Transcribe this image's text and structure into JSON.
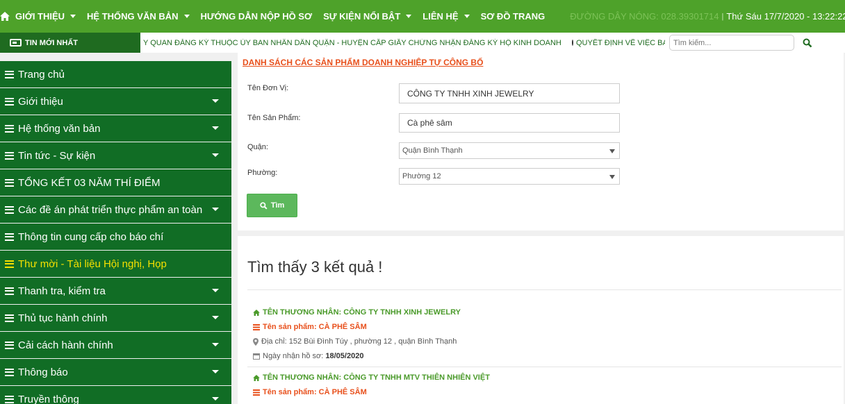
{
  "topnav": {
    "items": [
      {
        "label": "GIỚI THIỆU",
        "caret": true
      },
      {
        "label": "HỆ THỐNG VĂN BẢN",
        "caret": true
      },
      {
        "label": "HƯỚNG DẪN NỘP HỒ SƠ",
        "caret": false
      },
      {
        "label": "SỰ KIỆN NỔI BẬT",
        "caret": true
      },
      {
        "label": "LIÊN HỆ",
        "caret": true
      },
      {
        "label": "SƠ ĐỒ TRANG",
        "caret": false
      }
    ],
    "hotline": "ĐƯỜNG DÂY NÓNG: 028.39301714",
    "separator": "|",
    "datetime": "Thứ Sáu 17/7/2020 - 13:22:22"
  },
  "newsbar": {
    "label": "TIN MỚI NHẤT",
    "ticker": "Y QUAN ĐĂNG KÝ THUỘC ỦY BAN NHÂN DÂN QUẬN - HUYỆN CẤP GIẤY CHỨNG NHẬN ĐĂNG KÝ HỘ KINH DOANH",
    "ticker2": "QUYẾT ĐỊNH VỀ VIỆC BAN HÀNH",
    "search_placeholder": "Tìm kiếm..."
  },
  "sidebar": {
    "items": [
      {
        "label": "Trang chủ",
        "caret": false,
        "active": false
      },
      {
        "label": "Giới thiệu",
        "caret": true,
        "active": false
      },
      {
        "label": "Hệ thống văn bản",
        "caret": true,
        "active": false
      },
      {
        "label": "Tin tức - Sự kiện",
        "caret": true,
        "active": false
      },
      {
        "label": "TỔNG KẾT 03 NĂM THÍ ĐIỂM",
        "caret": false,
        "active": false
      },
      {
        "label": "Các đề án phát triển thực phẩm an toàn",
        "caret": true,
        "active": false
      },
      {
        "label": "Thông tin cung cấp cho báo chí",
        "caret": false,
        "active": false
      },
      {
        "label": "Thư mời - Tài liệu Hội nghị, Họp",
        "caret": false,
        "active": true
      },
      {
        "label": "Thanh tra, kiểm tra",
        "caret": true,
        "active": false
      },
      {
        "label": "Thủ tục hành chính",
        "caret": true,
        "active": false
      },
      {
        "label": "Cải cách hành chính",
        "caret": true,
        "active": false
      },
      {
        "label": "Thông báo",
        "caret": true,
        "active": false
      },
      {
        "label": "Truyền thông",
        "caret": true,
        "active": false
      }
    ]
  },
  "form": {
    "title": "DANH SÁCH CÁC SẢN PHẨM DOANH NGHIỆP TỰ CÔNG BỐ",
    "unit_label": "Tên Đơn Vị:",
    "unit_value": "CÔNG TY TNHH XINH JEWELRY",
    "product_label": "Tên Sản Phẩm:",
    "product_value": "Cà phê sâm",
    "district_label": "Quận:",
    "district_value": "Quận Bình Thạnh",
    "ward_label": "Phường:",
    "ward_value": "Phường 12",
    "search_button": "Tìm"
  },
  "results": {
    "title": "Tìm thấy 3 kết quả !",
    "items": [
      {
        "merchant": "TÊN THƯƠNG NHÂN: CÔNG TY TNHH XINH JEWELRY",
        "product": "Tên sản phẩm: CÀ PHÊ SÂM",
        "address": "Địa chỉ: 152 Bùi Đình Túy , phường 12 , quận Bình Thạnh",
        "date_label": "Ngày nhận hồ sơ:",
        "date_value": "18/05/2020"
      },
      {
        "merchant": "TÊN THƯƠNG NHÂN: CÔNG TY TNHH MTV THIÊN NHIÊN VIỆT",
        "product": "Tên sản phẩm: CÀ PHÊ SÂM"
      }
    ]
  },
  "colors": {
    "nav_green": "#4ea22a",
    "sidebar_green": "#116d25",
    "accent_orange": "#e8501c",
    "active_yellow": "#f5e000",
    "button_green": "#5cb85c"
  }
}
